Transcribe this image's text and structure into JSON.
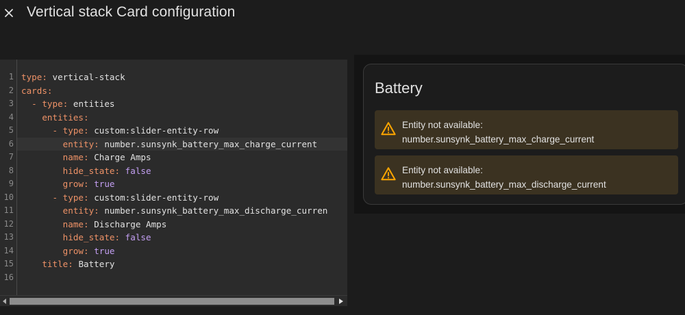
{
  "header": {
    "title": "Vertical stack Card configuration",
    "close_icon": "close-icon"
  },
  "editor": {
    "line_numbers": [
      "1",
      "2",
      "3",
      "4",
      "5",
      "6",
      "7",
      "8",
      "9",
      "10",
      "11",
      "12",
      "13",
      "14",
      "15",
      "16"
    ],
    "active_line": 6,
    "lines": [
      {
        "indent": "",
        "dash": "",
        "key": "type",
        "value": "vertical-stack",
        "vtype": "str"
      },
      {
        "indent": "",
        "dash": "",
        "key": "cards",
        "value": "",
        "vtype": "str"
      },
      {
        "indent": "  ",
        "dash": "- ",
        "key": "type",
        "value": "entities",
        "vtype": "str"
      },
      {
        "indent": "    ",
        "dash": "",
        "key": "entities",
        "value": "",
        "vtype": "str"
      },
      {
        "indent": "      ",
        "dash": "- ",
        "key": "type",
        "value": "custom:slider-entity-row",
        "vtype": "str"
      },
      {
        "indent": "        ",
        "dash": "",
        "key": "entity",
        "value": "number.sunsynk_battery_max_charge_current",
        "vtype": "str"
      },
      {
        "indent": "        ",
        "dash": "",
        "key": "name",
        "value": "Charge Amps",
        "vtype": "str"
      },
      {
        "indent": "        ",
        "dash": "",
        "key": "hide_state",
        "value": "false",
        "vtype": "bool"
      },
      {
        "indent": "        ",
        "dash": "",
        "key": "grow",
        "value": "true",
        "vtype": "bool"
      },
      {
        "indent": "      ",
        "dash": "- ",
        "key": "type",
        "value": "custom:slider-entity-row",
        "vtype": "str"
      },
      {
        "indent": "        ",
        "dash": "",
        "key": "entity",
        "value": "number.sunsynk_battery_max_discharge_curren",
        "vtype": "str"
      },
      {
        "indent": "        ",
        "dash": "",
        "key": "name",
        "value": "Discharge Amps",
        "vtype": "str"
      },
      {
        "indent": "        ",
        "dash": "",
        "key": "hide_state",
        "value": "false",
        "vtype": "bool"
      },
      {
        "indent": "        ",
        "dash": "",
        "key": "grow",
        "value": "true",
        "vtype": "bool"
      },
      {
        "indent": "    ",
        "dash": "",
        "key": "title",
        "value": "Battery",
        "vtype": "str"
      },
      {
        "indent": "",
        "dash": "",
        "key": "",
        "value": "",
        "vtype": "str"
      }
    ],
    "colors": {
      "key": "#ee9267",
      "bool": "#c39ff2",
      "text": "#e1e1e1"
    }
  },
  "preview": {
    "card_title": "Battery",
    "warnings": [
      {
        "heading": "Entity not available:",
        "entity": "number.sunsynk_battery_max_charge_current",
        "icon": "warning-icon"
      },
      {
        "heading": "Entity not available:",
        "entity": "number.sunsynk_battery_max_discharge_current",
        "icon": "warning-icon"
      }
    ],
    "colors": {
      "warning": "#ffa600",
      "warning_bg": "#3b3221"
    }
  }
}
